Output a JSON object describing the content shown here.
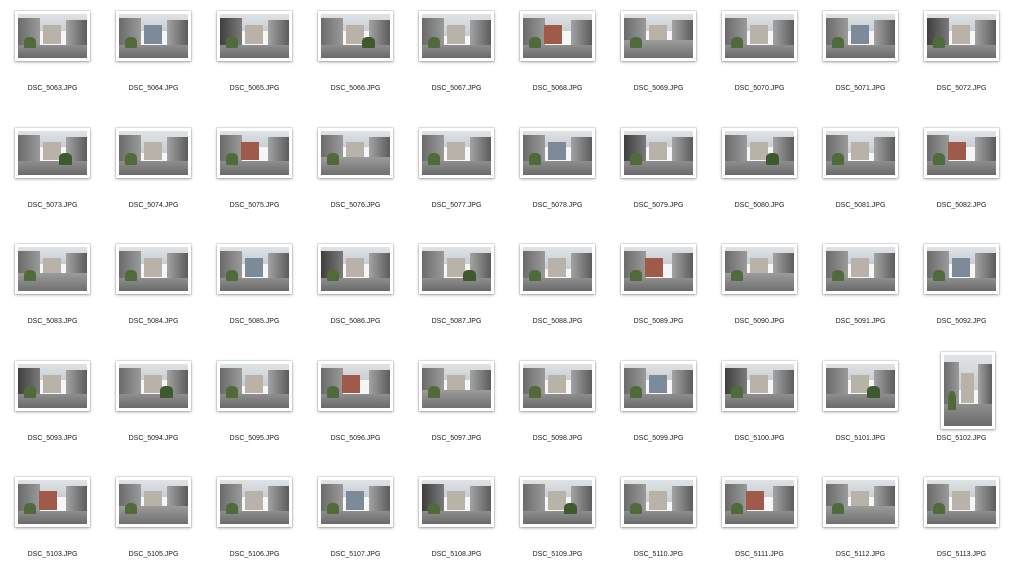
{
  "files": [
    {
      "name": "DSC_5063.JPG"
    },
    {
      "name": "DSC_5064.JPG"
    },
    {
      "name": "DSC_5065.JPG"
    },
    {
      "name": "DSC_5066.JPG"
    },
    {
      "name": "DSC_5067.JPG"
    },
    {
      "name": "DSC_5068.JPG"
    },
    {
      "name": "DSC_5069.JPG"
    },
    {
      "name": "DSC_5070.JPG"
    },
    {
      "name": "DSC_5071.JPG"
    },
    {
      "name": "DSC_5072.JPG"
    },
    {
      "name": "DSC_5073.JPG"
    },
    {
      "name": "DSC_5074.JPG"
    },
    {
      "name": "DSC_5075.JPG"
    },
    {
      "name": "DSC_5076.JPG"
    },
    {
      "name": "DSC_5077.JPG"
    },
    {
      "name": "DSC_5078.JPG"
    },
    {
      "name": "DSC_5079.JPG"
    },
    {
      "name": "DSC_5080.JPG"
    },
    {
      "name": "DSC_5081.JPG"
    },
    {
      "name": "DSC_5082.JPG"
    },
    {
      "name": "DSC_5083.JPG"
    },
    {
      "name": "DSC_5084.JPG"
    },
    {
      "name": "DSC_5085.JPG"
    },
    {
      "name": "DSC_5086.JPG"
    },
    {
      "name": "DSC_5087.JPG"
    },
    {
      "name": "DSC_5088.JPG"
    },
    {
      "name": "DSC_5089.JPG"
    },
    {
      "name": "DSC_5090.JPG"
    },
    {
      "name": "DSC_5091.JPG"
    },
    {
      "name": "DSC_5092.JPG"
    },
    {
      "name": "DSC_5093.JPG"
    },
    {
      "name": "DSC_5094.JPG"
    },
    {
      "name": "DSC_5095.JPG"
    },
    {
      "name": "DSC_5096.JPG"
    },
    {
      "name": "DSC_5097.JPG"
    },
    {
      "name": "DSC_5098.JPG"
    },
    {
      "name": "DSC_5099.JPG"
    },
    {
      "name": "DSC_5100.JPG"
    },
    {
      "name": "DSC_5101.JPG"
    },
    {
      "name": "DSC_5102.JPG",
      "orientation": "portrait"
    },
    {
      "name": "DSC_5103.JPG"
    },
    {
      "name": "DSC_5105.JPG"
    },
    {
      "name": "DSC_5106.JPG"
    },
    {
      "name": "DSC_5107.JPG"
    },
    {
      "name": "DSC_5108.JPG"
    },
    {
      "name": "DSC_5109.JPG"
    },
    {
      "name": "DSC_5110.JPG"
    },
    {
      "name": "DSC_5111.JPG"
    },
    {
      "name": "DSC_5112.JPG"
    },
    {
      "name": "DSC_5113.JPG"
    }
  ]
}
